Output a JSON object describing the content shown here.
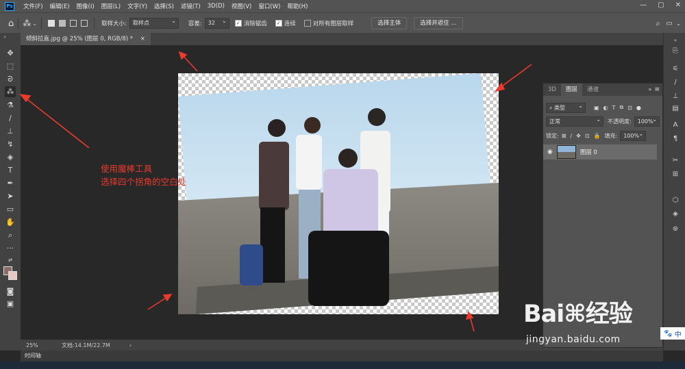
{
  "app": {
    "logo": "Ps",
    "title": ""
  },
  "menu": [
    "文件(F)",
    "编辑(E)",
    "图像(I)",
    "图层(L)",
    "文字(Y)",
    "选择(S)",
    "滤镜(T)",
    "3D(D)",
    "视图(V)",
    "窗口(W)",
    "帮助(H)"
  ],
  "window_controls": [
    "—",
    "▢",
    "✕"
  ],
  "options": {
    "sample_size_label": "取样大小:",
    "sample_size_value": "取样点",
    "tolerance_label": "容差:",
    "tolerance_value": "32",
    "antialias_label": "消除锯齿",
    "contiguous_label": "连续",
    "all_layers_label": "对所有图层取样",
    "select_subject": "选择主体",
    "select_mask": "选择并遮住 ..."
  },
  "document_tab": {
    "label": "倾斜拉直.jpg @ 25% (图层 0, RGB/8) *",
    "close": "×"
  },
  "status": {
    "zoom": "25%",
    "doc": "文档:14.1M/22.7M",
    "arrow": "›"
  },
  "timeline_label": "时间轴",
  "layers_panel": {
    "tabs": [
      "3D",
      "图层",
      "通道"
    ],
    "active_tab": "图层",
    "filter_type": "类型",
    "blend_mode": "正常",
    "opacity_label": "不透明度:",
    "opacity_value": "100%",
    "lock_label": "锁定:",
    "fill_label": "填充:",
    "fill_value": "100%",
    "layer_name": "图层 0"
  },
  "annotation": {
    "line1": "使用魔棒工具",
    "line2": "选择四个拐角的空白处",
    "color": "#e83a2d"
  },
  "watermark": {
    "logo": "Bai⌘经验",
    "url": "jingyan.baidu.com"
  },
  "ime": {
    "icon": "🐾",
    "label": "中"
  },
  "colors": {
    "accent": "#31a8ff",
    "annotation": "#e83a2d",
    "ui_bg": "#535353",
    "canvas_bg": "#282828"
  }
}
